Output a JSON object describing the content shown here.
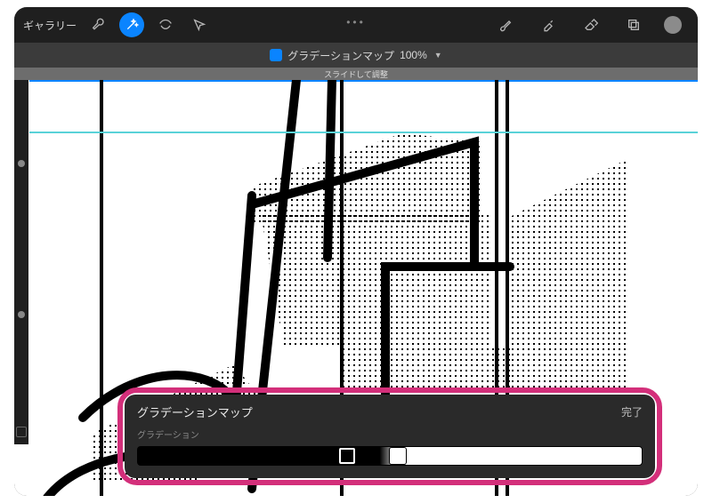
{
  "toolbar": {
    "gallery_label": "ギャラリー",
    "icons": {
      "wrench": "tool-adjustments",
      "magic": "tool-magic-wand",
      "select": "tool-selection",
      "move": "tool-move",
      "brush": "tool-brush",
      "smudge": "tool-smudge",
      "erase": "tool-eraser",
      "layers": "tool-layers"
    },
    "active_tool": "tool-magic-wand",
    "color_swatch": "#8b8b8b"
  },
  "subheader": {
    "title": "グラデーションマップ",
    "percent": "100%"
  },
  "hint": "スライドして調整",
  "panel": {
    "title": "グラデーションマップ",
    "done_label": "完了",
    "section_label": "グラデーション",
    "stops": [
      {
        "color": "#000000",
        "position": 0.42
      },
      {
        "color": "#ffffff",
        "position": 0.52
      }
    ]
  }
}
